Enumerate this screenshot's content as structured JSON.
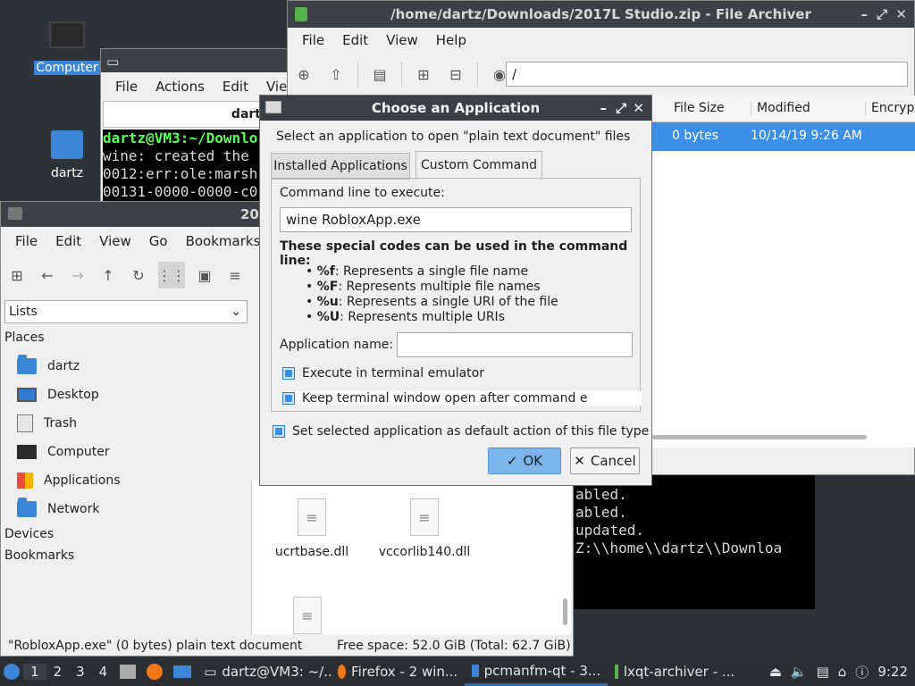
{
  "desktop": {
    "icons": [
      {
        "label": "Computer"
      },
      {
        "label": "dartz"
      }
    ]
  },
  "terminal": {
    "lines": [
      "dartz@VM3:~/Downlo",
      "wine: created the",
      "0012:err:ole:marsh",
      "00131-0000-0000-c0"
    ],
    "menu": [
      "File",
      "Actions",
      "Edit",
      "View"
    ],
    "tab_label": "dart",
    "lower_lines": [
      "abled.",
      "abled.",
      "updated.",
      "Z:\\\\home\\\\dartz\\\\Downloa"
    ]
  },
  "archiver": {
    "title": "/home/dartz/Downloads/2017L Studio.zip - File Archiver",
    "menu": [
      "File",
      "Edit",
      "View",
      "Help"
    ],
    "path": "/",
    "columns": [
      "File Size",
      "Modified",
      "Encryp"
    ],
    "row": {
      "size": "0 bytes",
      "modified": "10/14/19 9:26 AM"
    }
  },
  "filemanager": {
    "title": "20",
    "menu": [
      "File",
      "Edit",
      "View",
      "Go",
      "Bookmarks"
    ],
    "view_select": "Lists",
    "sections": {
      "places": "Places",
      "devices": "Devices",
      "bookmarks": "Bookmarks"
    },
    "places": [
      "dartz",
      "Desktop",
      "Trash",
      "Computer",
      "Applications",
      "Network"
    ],
    "files": [
      "ucrtbase.dll",
      "vccorlib140.dll"
    ],
    "status_left": "\"RobloxApp.exe\" (0 bytes) plain text document",
    "status_right": "Free space: 52.0 GiB (Total: 62.7 GiB)"
  },
  "dialog": {
    "title": "Choose an Application",
    "subtitle": "Select an application to open \"plain text document\" files",
    "tabs": [
      "Installed Applications",
      "Custom Command"
    ],
    "cmd_label": "Command line to execute:",
    "cmd_value": "wine RobloxApp.exe",
    "codes_header": "These special codes can be used in the command line:",
    "codes": [
      {
        "code": "%f",
        "desc": ": Represents a single file name"
      },
      {
        "code": "%F",
        "desc": ": Represents multiple file names"
      },
      {
        "code": "%u",
        "desc": ": Represents a single URI of the file"
      },
      {
        "code": "%U",
        "desc": ": Represents multiple URIs"
      }
    ],
    "appname_label": "Application name:",
    "appname_value": "",
    "chk_terminal": "Execute in terminal emulator",
    "chk_keep": "Keep terminal window open after command e",
    "chk_default": "Set selected application as default action of this file type",
    "ok": "OK",
    "cancel": "Cancel"
  },
  "taskbar": {
    "desktops": [
      "1",
      "2",
      "3",
      "4"
    ],
    "tasks": [
      {
        "label": "dartz@VM3: ~/..."
      },
      {
        "label": "Firefox - 2 win..."
      },
      {
        "label": "pcmanfm-qt - 3..."
      },
      {
        "label": "lxqt-archiver - ..."
      }
    ],
    "clock": "9:22"
  }
}
